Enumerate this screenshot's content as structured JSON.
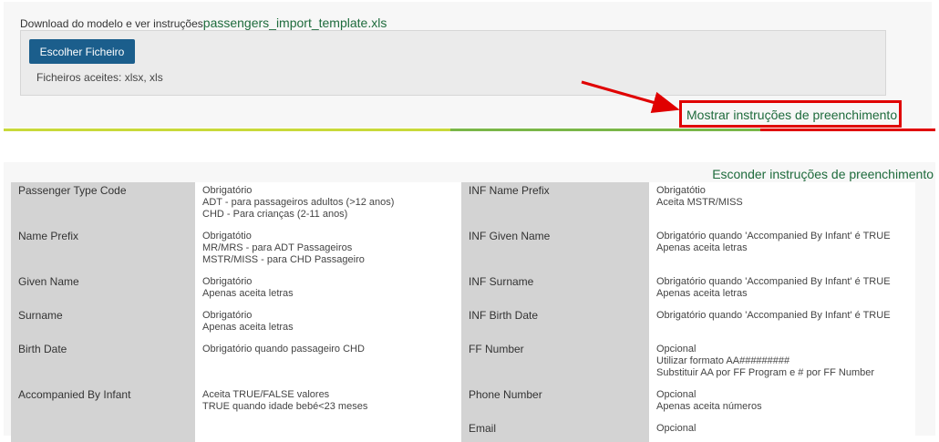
{
  "upload": {
    "download_text": "Download do modelo e ver instruções",
    "template_link": "passengers_import_template.xls",
    "choose_button": "Escolher Ficheiro",
    "accepted_files": "Ficheiros aceites: xlsx, xls",
    "show_instructions": "Mostrar instruções de preenchimento"
  },
  "colors": {
    "progress": [
      "#c8d93a",
      "#7ab648",
      "#e00000"
    ],
    "button": "#1b5e8c",
    "link": "#1e6b3c",
    "highlight": "#e00000"
  },
  "instructions": {
    "hide_label": "Esconder instruções de preenchimento",
    "rows": [
      {
        "left_label": "Passenger Type Code",
        "left_lines": [
          "Obrigatório",
          "ADT - para passageiros adultos (>12 anos)",
          "CHD - Para crianças (2-11 anos)"
        ],
        "right_label": "INF Name Prefix",
        "right_lines": [
          "Obrigatótio",
          "Aceita MSTR/MISS"
        ]
      },
      {
        "left_label": "Name Prefix",
        "left_lines": [
          "Obrigatótio",
          "MR/MRS - para ADT Passageiros",
          "MSTR/MISS - para CHD Passageiro"
        ],
        "right_label": "INF Given Name",
        "right_lines": [
          "Obrigatório quando 'Accompanied By Infant' é TRUE",
          "Apenas aceita letras"
        ]
      },
      {
        "left_label": "Given Name",
        "left_lines": [
          "Obrigatório",
          "Apenas aceita letras"
        ],
        "right_label": "INF Surname",
        "right_lines": [
          "Obrigatório quando 'Accompanied By Infant' é TRUE",
          "Apenas aceita letras"
        ]
      },
      {
        "left_label": "Surname",
        "left_lines": [
          "Obrigatório",
          "Apenas aceita letras"
        ],
        "right_label": "INF Birth Date",
        "right_lines": [
          "Obrigatório quando 'Accompanied By Infant' é TRUE"
        ]
      },
      {
        "left_label": "Birth Date",
        "left_lines": [
          "Obrigatório quando passageiro CHD"
        ],
        "right_label": "FF Number",
        "right_lines": [
          "Opcional",
          "Utilizar formato AA#########",
          "Substituir AA por FF Program e # por FF Number"
        ]
      },
      {
        "left_label": "Accompanied By Infant",
        "left_lines": [
          "Aceita TRUE/FALSE valores",
          "TRUE quando idade bebé<23 meses"
        ],
        "right_label": "Phone Number",
        "right_lines": [
          "Opcional",
          "Apenas aceita números"
        ]
      },
      {
        "left_label": "",
        "left_lines": [],
        "right_label": "Email",
        "right_lines": [
          "Opcional"
        ]
      }
    ]
  }
}
